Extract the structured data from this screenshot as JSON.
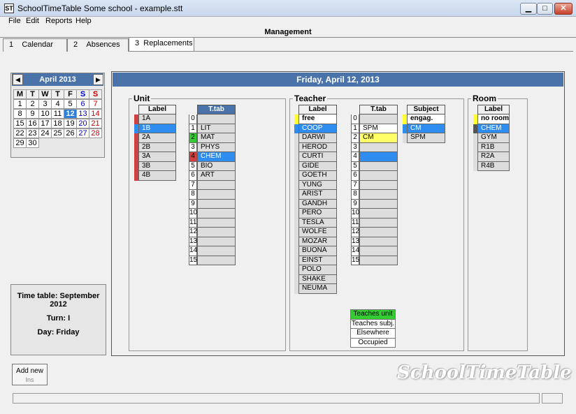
{
  "window": {
    "title": "SchoolTimeTable Some school - example.stt",
    "icon": "app-icon",
    "min": "▁",
    "max": "□",
    "close": "✕"
  },
  "menu": [
    "File",
    "Edit",
    "Reports",
    "Help"
  ],
  "header": "Management",
  "tabs": [
    {
      "num": "1",
      "label": "Calendar"
    },
    {
      "num": "2",
      "label": "Absences"
    },
    {
      "num": "3",
      "label": "Replacements"
    }
  ],
  "calendar": {
    "month": "April 2013",
    "prev": "◀",
    "next": "▶",
    "days": [
      "M",
      "T",
      "W",
      "T",
      "F",
      "S",
      "S"
    ],
    "weeks": [
      [
        "",
        "",
        "",
        "",
        "",
        "",
        "1"
      ],
      [
        "1",
        "2",
        "3",
        "4",
        "5",
        "6",
        "7"
      ],
      [
        "8",
        "9",
        "10",
        "11",
        "12",
        "13",
        "14"
      ],
      [
        "15",
        "16",
        "17",
        "18",
        "19",
        "20",
        "21"
      ],
      [
        "22",
        "23",
        "24",
        "25",
        "26",
        "27",
        "28"
      ],
      [
        "29",
        "30",
        "",
        "",
        "",
        "",
        ""
      ]
    ],
    "today": "12"
  },
  "info": {
    "timetable": "Time table: September 2012",
    "turn": "Turn: I",
    "day": "Day: Friday"
  },
  "day_header": "Friday, April 12, 2013",
  "unit": {
    "title": "Unit",
    "label_header": "Label",
    "ttab_header": "T.tab",
    "labels": [
      "1A",
      "1B",
      "2A",
      "2B",
      "3A",
      "3B",
      "4B"
    ],
    "periods": [
      "0",
      "1",
      "2",
      "3",
      "4",
      "5",
      "6",
      "7",
      "8",
      "9",
      "10",
      "11",
      "12",
      "13",
      "14",
      "15"
    ],
    "subjects": [
      "",
      "LIT",
      "MAT",
      "PHYS",
      "CHEM",
      "BIO",
      "ART",
      "",
      "",
      "",
      "",
      "",
      "",
      "",
      "",
      ""
    ]
  },
  "teacher": {
    "title": "Teacher",
    "label_header": "Label",
    "ttab_header": "T.tab",
    "subject_header": "Subject",
    "labels": [
      "free",
      "COOP",
      "DARWI",
      "HEROD",
      "CURTI",
      "GIDE",
      "GOETH",
      "YUNG",
      "ARIST",
      "GANDH",
      "PERO",
      "TESLA",
      "WOLFE",
      "MOZAR",
      "BUONA",
      "EINST",
      "POLO",
      "SHAKE",
      "NEUMA"
    ],
    "periods": [
      "0",
      "1",
      "2",
      "3",
      "4",
      "5",
      "6",
      "7",
      "8",
      "9",
      "10",
      "11",
      "12",
      "13",
      "14",
      "15"
    ],
    "ttab": [
      "",
      "SPM",
      "CM",
      "",
      "",
      "",
      "",
      "",
      "",
      "",
      "",
      "",
      "",
      "",
      "",
      ""
    ],
    "subjects": [
      "engag.",
      "CM",
      "SPM"
    ]
  },
  "legend": [
    "Teaches unit",
    "Teaches subj.",
    "Elsewhere",
    "Occupied"
  ],
  "room": {
    "title": "Room",
    "label_header": "Label",
    "labels": [
      "no room",
      "CHEM",
      "GYM",
      "R1B",
      "R2A",
      "R4B"
    ]
  },
  "add_button": {
    "label": "Add new",
    "shortcut": "Ins"
  },
  "watermark": "SchoolTimeTable",
  "colors": {
    "accent": "#4a74a9",
    "selected": "#2f8df0",
    "red": "#d04040",
    "green": "#33cc33",
    "yellow": "#ffff66"
  }
}
